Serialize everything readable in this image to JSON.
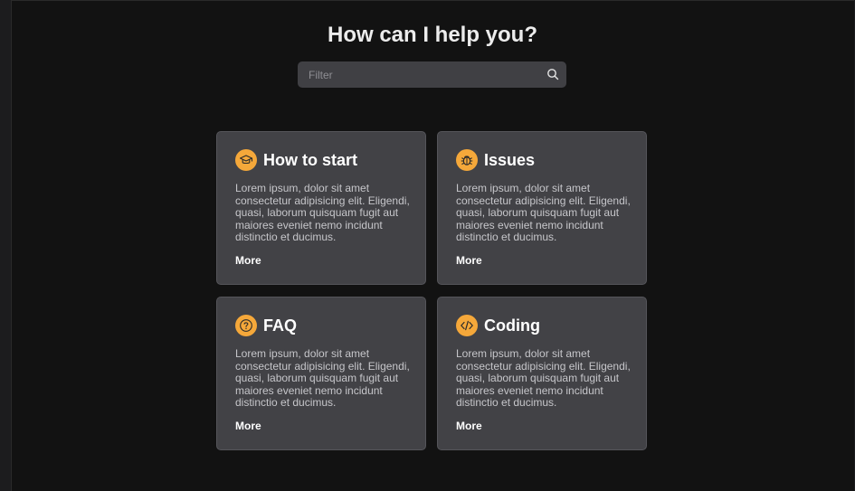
{
  "header": {
    "title": "How can I help you?"
  },
  "search": {
    "placeholder": "Filter",
    "value": ""
  },
  "colors": {
    "accent": "#f5a83a",
    "card_bg": "#424246",
    "page_bg": "#121212"
  },
  "cards": [
    {
      "icon": "graduation-cap-icon",
      "title": "How to start",
      "body": "Lorem ipsum, dolor sit amet consectetur adipisicing elit. Eligendi, quasi, laborum quisquam fugit aut maiores eveniet nemo incidunt distinctio et ducimus.",
      "more": "More"
    },
    {
      "icon": "bug-icon",
      "title": "Issues",
      "body": "Lorem ipsum, dolor sit amet consectetur adipisicing elit. Eligendi, quasi, laborum quisquam fugit aut maiores eveniet nemo incidunt distinctio et ducimus.",
      "more": "More"
    },
    {
      "icon": "question-icon",
      "title": "FAQ",
      "body": "Lorem ipsum, dolor sit amet consectetur adipisicing elit. Eligendi, quasi, laborum quisquam fugit aut maiores eveniet nemo incidunt distinctio et ducimus.",
      "more": "More"
    },
    {
      "icon": "code-icon",
      "title": "Coding",
      "body": "Lorem ipsum, dolor sit amet consectetur adipisicing elit. Eligendi, quasi, laborum quisquam fugit aut maiores eveniet nemo incidunt distinctio et ducimus.",
      "more": "More"
    }
  ]
}
